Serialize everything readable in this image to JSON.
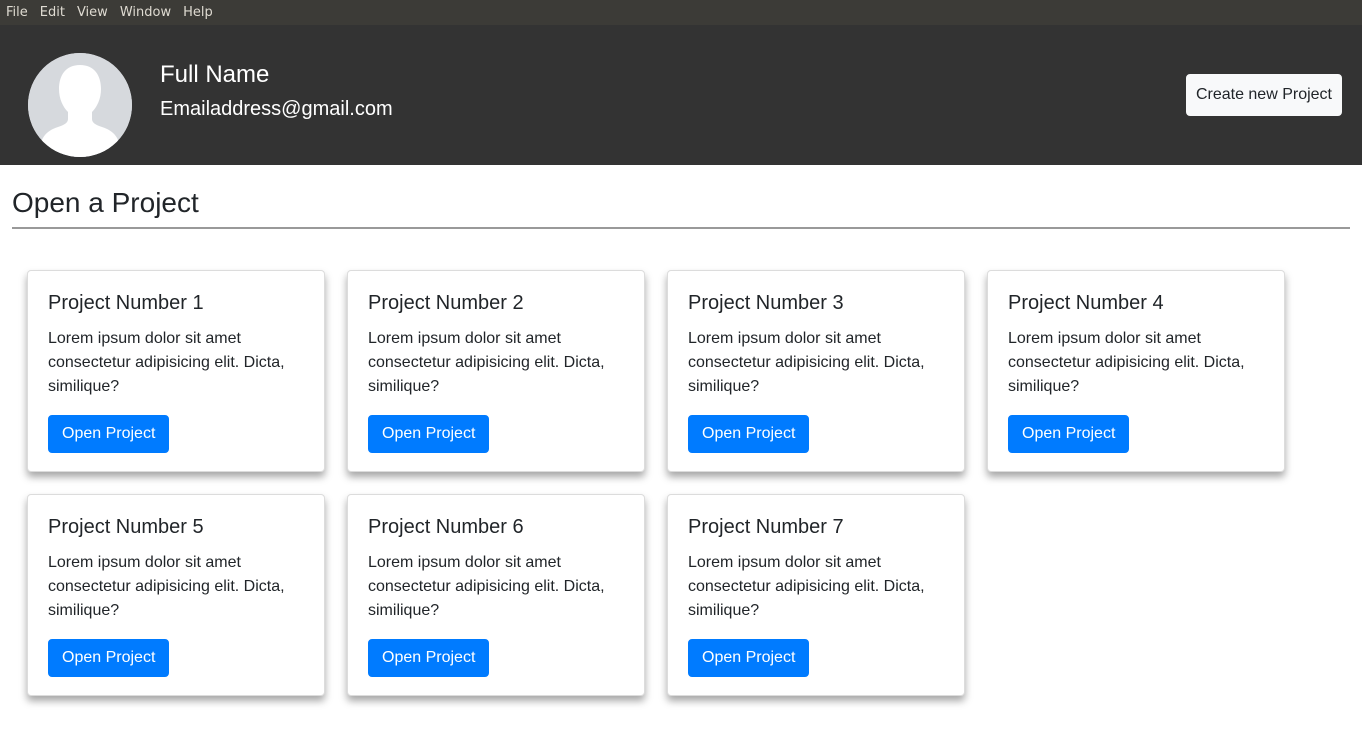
{
  "menubar": {
    "items": [
      "File",
      "Edit",
      "View",
      "Window",
      "Help"
    ]
  },
  "header": {
    "avatar_icon": "user-silhouette-icon",
    "full_name": "Full Name",
    "email": "Emailaddress@gmail.com",
    "create_button_label": "Create new Project"
  },
  "main": {
    "title": "Open a Project",
    "projects": [
      {
        "title": "Project Number 1",
        "description": "Lorem ipsum dolor sit amet consectetur adipisicing elit. Dicta, similique?",
        "button_label": "Open Project"
      },
      {
        "title": "Project Number 2",
        "description": "Lorem ipsum dolor sit amet consectetur adipisicing elit. Dicta, similique?",
        "button_label": "Open Project"
      },
      {
        "title": "Project Number 3",
        "description": "Lorem ipsum dolor sit amet consectetur adipisicing elit. Dicta, similique?",
        "button_label": "Open Project"
      },
      {
        "title": "Project Number 4",
        "description": "Lorem ipsum dolor sit amet consectetur adipisicing elit. Dicta, similique?",
        "button_label": "Open Project"
      },
      {
        "title": "Project Number 5",
        "description": "Lorem ipsum dolor sit amet consectetur adipisicing elit. Dicta, similique?",
        "button_label": "Open Project"
      },
      {
        "title": "Project Number 6",
        "description": "Lorem ipsum dolor sit amet consectetur adipisicing elit. Dicta, similique?",
        "button_label": "Open Project"
      },
      {
        "title": "Project Number 7",
        "description": "Lorem ipsum dolor sit amet consectetur adipisicing elit. Dicta, similique?",
        "button_label": "Open Project"
      }
    ]
  },
  "colors": {
    "menubar_bg": "#3c3b37",
    "header_bg": "#333333",
    "primary": "#007bff",
    "avatar_bg": "#d6d9dd"
  }
}
